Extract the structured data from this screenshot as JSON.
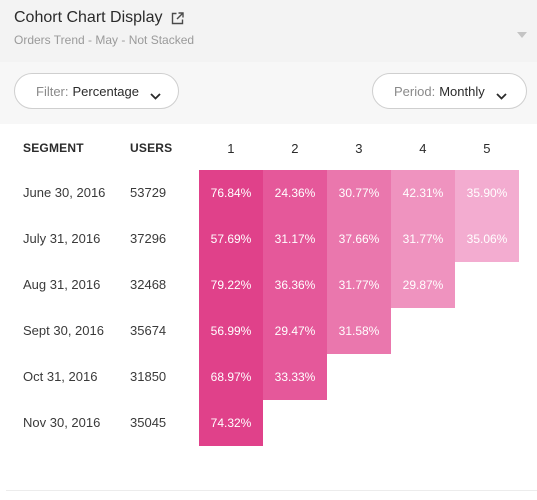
{
  "header": {
    "title": "Cohort Chart Display",
    "subtitle": "Orders Trend - May - Not Stacked",
    "external_icon": "external-link-icon",
    "collapse_icon": "caret-down-icon"
  },
  "filters": {
    "filter": {
      "label": "Filter:",
      "value": "Percentage"
    },
    "period": {
      "label": "Period:",
      "value": "Monthly"
    }
  },
  "table": {
    "columns": {
      "segment": "SEGMENT",
      "users": "USERS",
      "periods": [
        "1",
        "2",
        "3",
        "4",
        "5"
      ]
    },
    "rows": [
      {
        "segment": "June 30, 2016",
        "users": "53729",
        "values": [
          "76.84%",
          "24.36%",
          "30.77%",
          "42.31%",
          "35.90%"
        ]
      },
      {
        "segment": "July 31, 2016",
        "users": "37296",
        "values": [
          "57.69%",
          "31.17%",
          "37.66%",
          "31.77%",
          "35.06%"
        ]
      },
      {
        "segment": "Aug 31, 2016",
        "users": "32468",
        "values": [
          "79.22%",
          "36.36%",
          "31.77%",
          "29.87%"
        ]
      },
      {
        "segment": "Sept 30, 2016",
        "users": "35674",
        "values": [
          "56.99%",
          "29.47%",
          "31.58%"
        ]
      },
      {
        "segment": "Oct 31, 2016",
        "users": "31850",
        "values": [
          "68.97%",
          "33.33%"
        ]
      },
      {
        "segment": "Nov 30, 2016",
        "users": "35045",
        "values": [
          "74.32%"
        ]
      }
    ],
    "period_colors": [
      "#e0418a",
      "#e5589a",
      "#ea77ad",
      "#ef93bf",
      "#f3acd0"
    ]
  }
}
